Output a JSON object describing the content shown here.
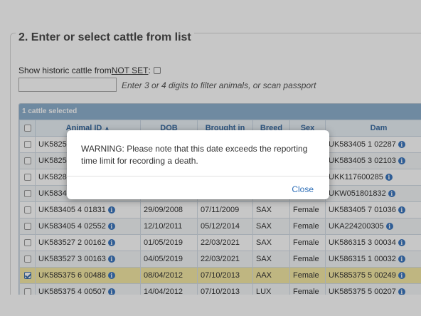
{
  "section": {
    "title": "2. Enter or select cattle from list",
    "historic_label_pre": "Show historic cattle from ",
    "historic_label_link": "NOT SET",
    "historic_label_post": ":",
    "filter_hint": "Enter 3 or 4 digits to filter animals, or scan passport"
  },
  "grid": {
    "selected_text": "1 cattle selected",
    "columns": [
      "",
      "Animal ID",
      "DOB",
      "Brought in",
      "Breed",
      "Sex",
      "Dam"
    ],
    "rows": [
      {
        "animal_id": "UK5825",
        "dob": "",
        "brought_in": "",
        "breed": "",
        "sex": "",
        "dam": "UK583405 1 02287",
        "checked": false
      },
      {
        "animal_id": "UK5825",
        "dob": "",
        "brought_in": "",
        "breed": "",
        "sex": "",
        "dam": "UK583405 3 02103",
        "checked": false
      },
      {
        "animal_id": "UK5828",
        "dob": "",
        "brought_in": "",
        "breed": "",
        "sex": "",
        "dam": "UKK117600285",
        "checked": false
      },
      {
        "animal_id": "UK5834",
        "dob": "",
        "brought_in": "",
        "breed": "",
        "sex": "",
        "dam": "UKW051801832",
        "checked": false
      },
      {
        "animal_id": "UK583405 4 01831",
        "dob": "29/09/2008",
        "brought_in": "07/11/2009",
        "breed": "SAX",
        "sex": "Female",
        "dam": "UK583405 7 01036",
        "checked": false
      },
      {
        "animal_id": "UK583405 4 02552",
        "dob": "12/10/2011",
        "brought_in": "05/12/2014",
        "breed": "SAX",
        "sex": "Female",
        "dam": "UKA224200305",
        "checked": false
      },
      {
        "animal_id": "UK583527 2 00162",
        "dob": "01/05/2019",
        "brought_in": "22/03/2021",
        "breed": "SAX",
        "sex": "Female",
        "dam": "UK586315 3 00034",
        "checked": false
      },
      {
        "animal_id": "UK583527 3 00163",
        "dob": "04/05/2019",
        "brought_in": "22/03/2021",
        "breed": "SAX",
        "sex": "Female",
        "dam": "UK586315 1 00032",
        "checked": false
      },
      {
        "animal_id": "UK585375 6 00488",
        "dob": "08/04/2012",
        "brought_in": "07/10/2013",
        "breed": "AAX",
        "sex": "Female",
        "dam": "UK585375 5 00249",
        "checked": true
      },
      {
        "animal_id": "UK585375 4 00507",
        "dob": "14/04/2012",
        "brought_in": "07/10/2013",
        "breed": "LUX",
        "sex": "Female",
        "dam": "UK585375 5 00207",
        "checked": false
      }
    ]
  },
  "modal": {
    "message": "WARNING: Please note that this date exceeds the reporting time limit for recording a death.",
    "close_label": "Close"
  },
  "icons": {
    "info": "info-icon",
    "sort": "sort-asc-icon"
  },
  "colors": {
    "grid_header": "#8fb1cf",
    "selected_row": "#f5e9a6",
    "link": "#2f6fb8"
  }
}
